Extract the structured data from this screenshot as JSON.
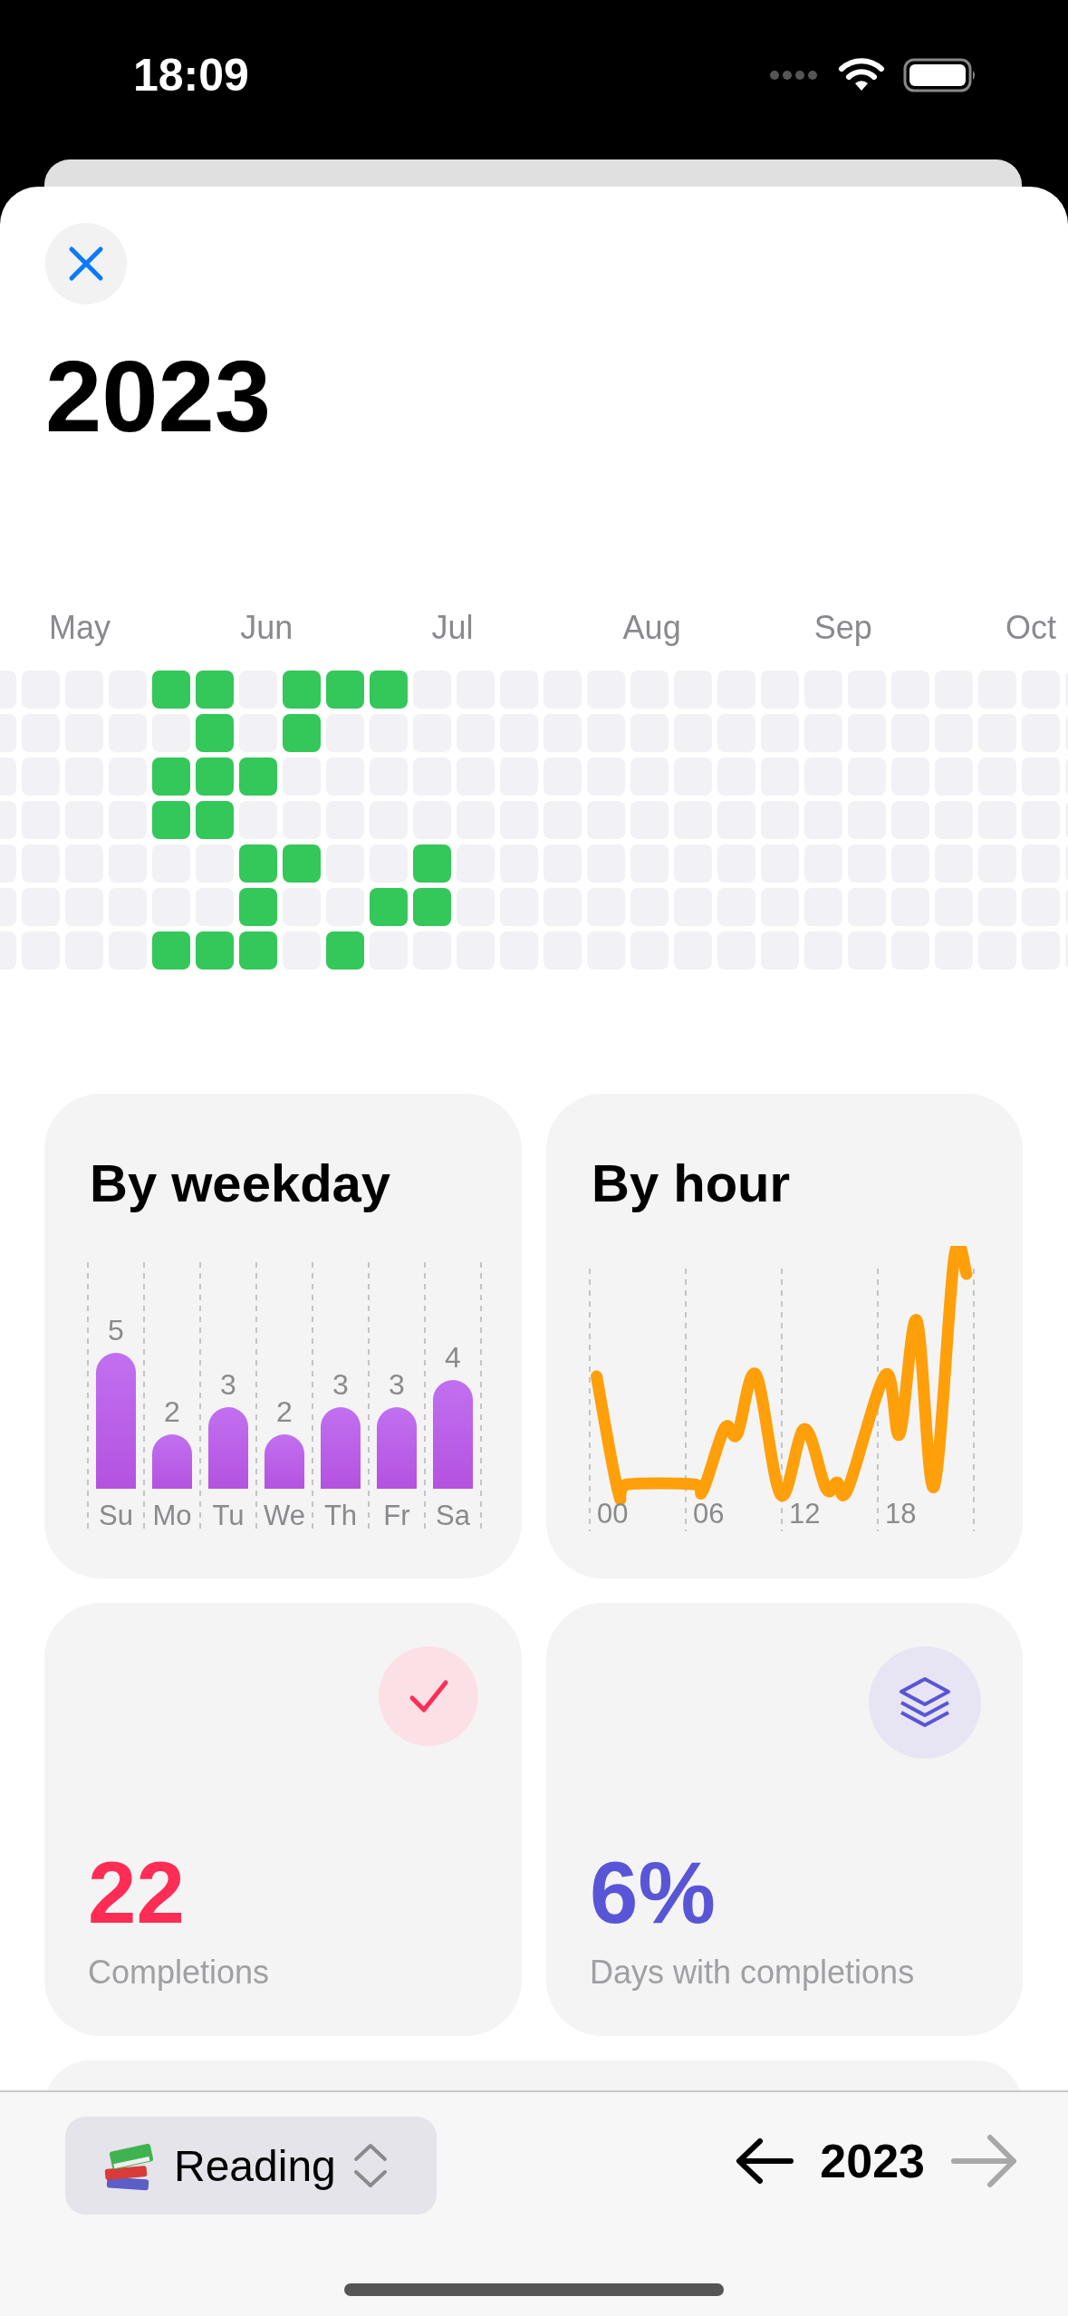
{
  "status_bar": {
    "time": "18:09"
  },
  "title": "2023",
  "heatmap": {
    "months": [
      "May",
      "Jun",
      "Jul",
      "Aug",
      "Sep",
      "Oct"
    ],
    "weeks": [
      {
        "days": [
          false,
          false,
          false,
          false,
          false,
          false,
          false
        ]
      },
      {
        "days": [
          false,
          false,
          false,
          false,
          false,
          false,
          false
        ]
      },
      {
        "days": [
          false,
          false,
          false,
          false,
          false,
          false,
          false
        ]
      },
      {
        "days": [
          false,
          false,
          false,
          false,
          false,
          false,
          false
        ]
      },
      {
        "days": [
          true,
          false,
          true,
          true,
          false,
          false,
          true
        ]
      },
      {
        "days": [
          true,
          true,
          true,
          true,
          false,
          false,
          true
        ]
      },
      {
        "days": [
          false,
          false,
          true,
          false,
          true,
          true,
          true
        ]
      },
      {
        "days": [
          true,
          true,
          false,
          false,
          true,
          false,
          false
        ]
      },
      {
        "days": [
          true,
          false,
          false,
          false,
          false,
          false,
          true
        ]
      },
      {
        "days": [
          true,
          false,
          false,
          false,
          false,
          true,
          false
        ]
      },
      {
        "days": [
          false,
          false,
          false,
          false,
          true,
          true,
          false
        ]
      },
      {
        "days": [
          false,
          false,
          false,
          false,
          false,
          false,
          false
        ]
      },
      {
        "days": [
          false,
          false,
          false,
          false,
          false,
          false,
          false
        ]
      },
      {
        "days": [
          false,
          false,
          false,
          false,
          false,
          false,
          false
        ]
      },
      {
        "days": [
          false,
          false,
          false,
          false,
          false,
          false,
          false
        ]
      },
      {
        "days": [
          false,
          false,
          false,
          false,
          false,
          false,
          false
        ]
      },
      {
        "days": [
          false,
          false,
          false,
          false,
          false,
          false,
          false
        ]
      },
      {
        "days": [
          false,
          false,
          false,
          false,
          false,
          false,
          false
        ]
      },
      {
        "days": [
          false,
          false,
          false,
          false,
          false,
          false,
          false
        ]
      },
      {
        "days": [
          false,
          false,
          false,
          false,
          false,
          false,
          false
        ]
      },
      {
        "days": [
          false,
          false,
          false,
          false,
          false,
          false,
          false
        ]
      },
      {
        "days": [
          false,
          false,
          false,
          false,
          false,
          false,
          false
        ]
      },
      {
        "days": [
          false,
          false,
          false,
          false,
          false,
          false,
          false
        ]
      },
      {
        "days": [
          false,
          false,
          false,
          false,
          false,
          false,
          false
        ]
      },
      {
        "days": [
          false,
          false,
          false,
          false,
          false,
          false,
          false
        ]
      },
      {
        "days": [
          false,
          false,
          false,
          false,
          false,
          false,
          false
        ]
      }
    ]
  },
  "by_weekday": {
    "title": "By weekday",
    "chart_data": {
      "type": "bar",
      "categories": [
        "Su",
        "Mo",
        "Tu",
        "We",
        "Th",
        "Fr",
        "Sa"
      ],
      "values": [
        5,
        2,
        3,
        2,
        3,
        3,
        4
      ],
      "data_labels": true
    }
  },
  "by_hour": {
    "title": "By hour",
    "x_labels": [
      "00",
      "06",
      "12",
      "18"
    ]
  },
  "stats": [
    {
      "kind": "completions",
      "value": "22",
      "label": "Completions",
      "color": "#ff2d55"
    },
    {
      "kind": "days",
      "value": "6%",
      "label": "Days with completions",
      "color": "#5856d6"
    }
  ],
  "bottom_bar": {
    "habit_picker": {
      "label": "Reading"
    },
    "year": "2023",
    "previous": {
      "disabled": false
    },
    "next": {
      "disabled": true
    }
  }
}
